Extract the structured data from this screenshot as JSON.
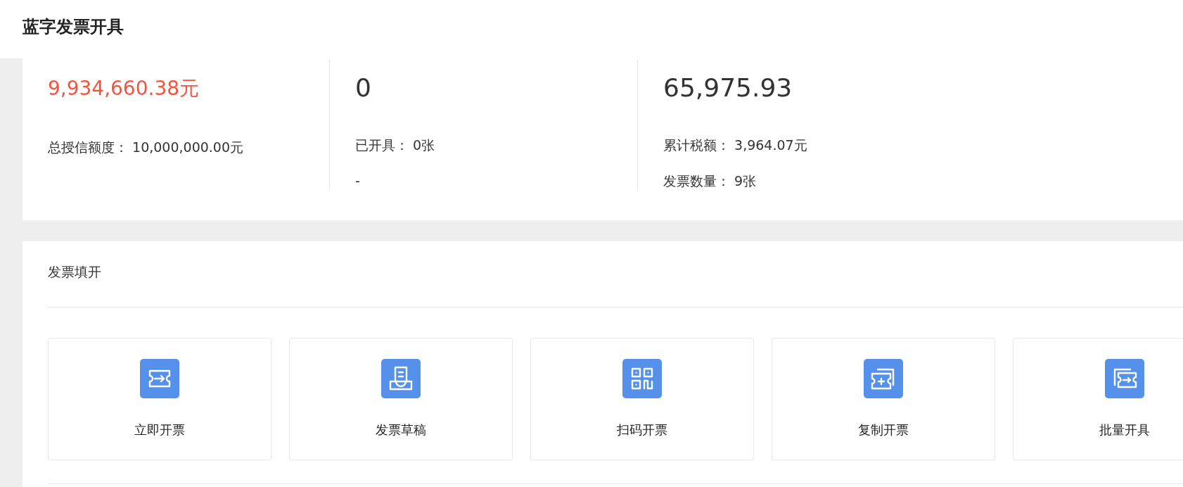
{
  "page_title": "蓝字发票开具",
  "stats": [
    {
      "value": "9,934,660.38元",
      "highlight": true,
      "lines": [
        {
          "label": "总授信额度：",
          "value": "10,000,000.00元"
        }
      ]
    },
    {
      "value": "0",
      "highlight": false,
      "lines": [
        {
          "label": "已开具：",
          "value": "0张"
        },
        {
          "label": "-"
        }
      ]
    },
    {
      "value": "65,975.93",
      "highlight": false,
      "lines": [
        {
          "label": "累计税额：",
          "value": "3,964.07元"
        },
        {
          "label": "发票数量：",
          "value": "9张"
        }
      ]
    }
  ],
  "section": {
    "title": "发票填开",
    "actions": [
      {
        "kind": "issue",
        "label": "立即开票"
      },
      {
        "kind": "draft",
        "label": "发票草稿"
      },
      {
        "kind": "scan",
        "label": "扫码开票"
      },
      {
        "kind": "copy",
        "label": "复制开票"
      },
      {
        "kind": "batch",
        "label": "批量开具"
      }
    ]
  }
}
